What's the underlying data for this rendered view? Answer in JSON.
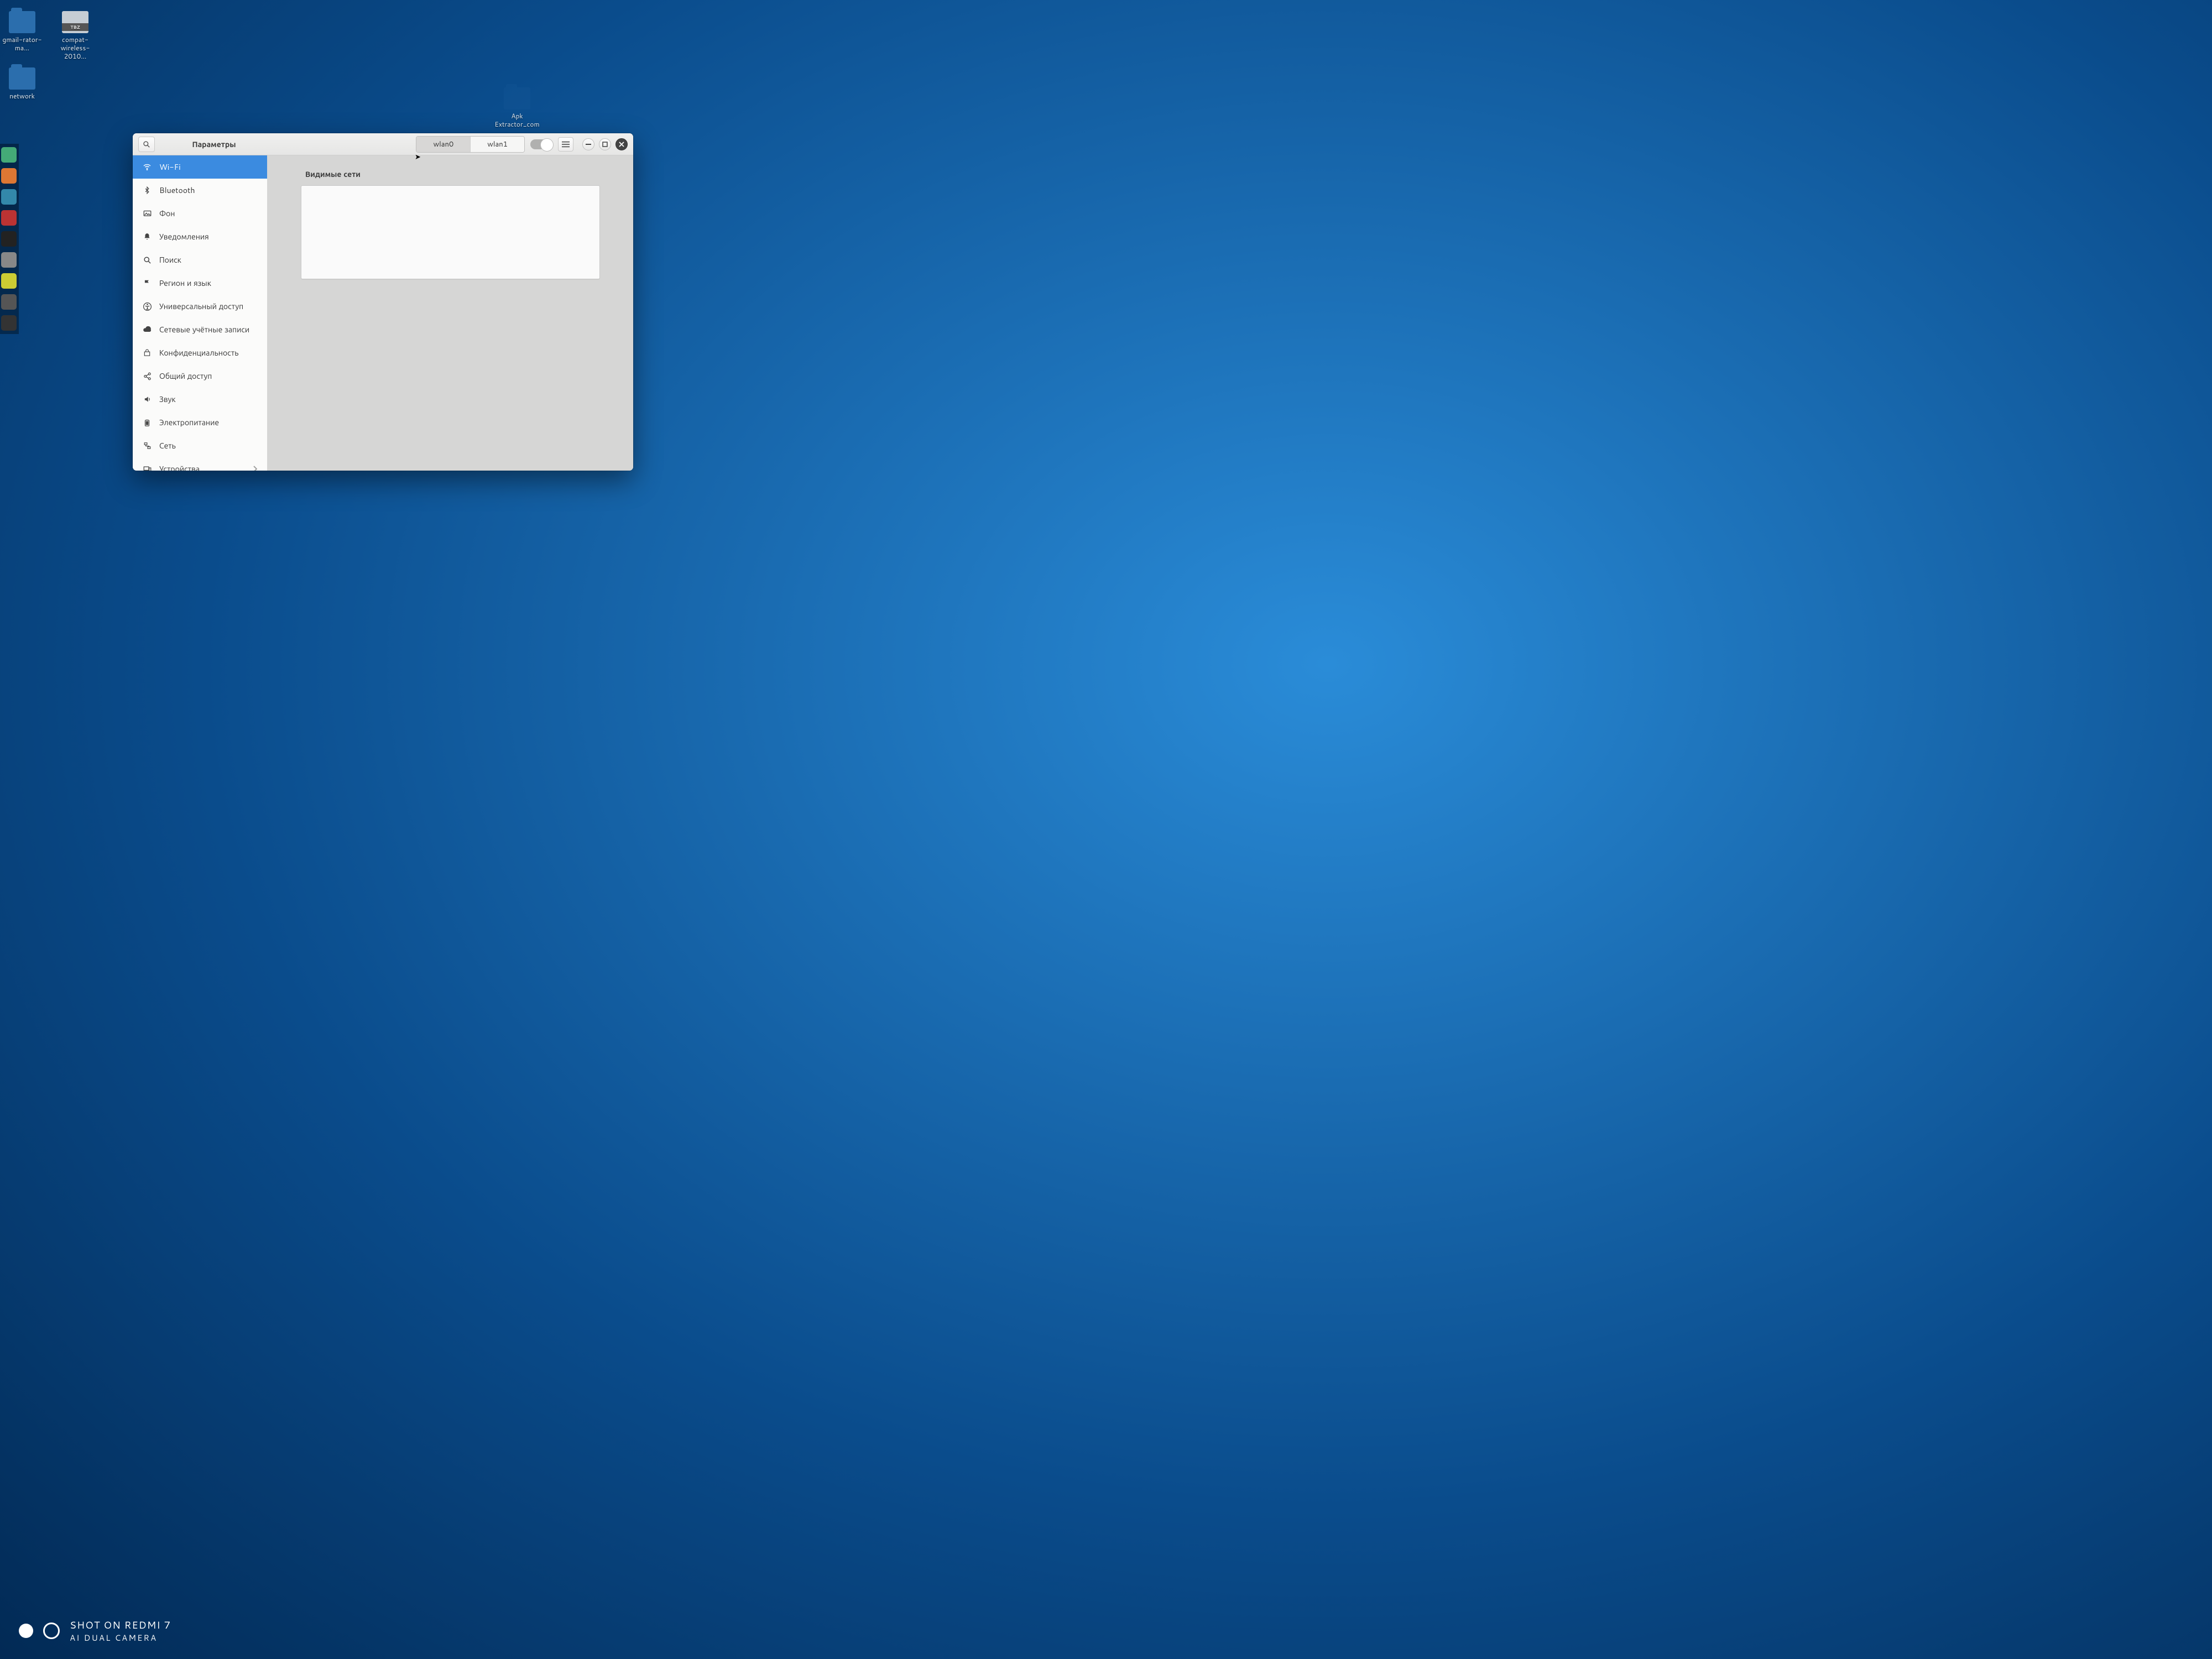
{
  "desktop": {
    "icons": [
      {
        "label": "gmail-rator-ma…",
        "type": "folder"
      },
      {
        "label": "compat-wireless-2010…",
        "type": "file"
      },
      {
        "label": "network",
        "type": "folder"
      },
      {
        "label": "Apk Extractor_com…",
        "type": "folder"
      }
    ]
  },
  "window": {
    "title": "Параметры",
    "tabs": [
      {
        "id": "wlan0",
        "label": "wlan0",
        "active": true
      },
      {
        "id": "wlan1",
        "label": "wlan1",
        "active": false
      }
    ],
    "wifi_toggle": false
  },
  "sidebar": {
    "items": [
      {
        "label": "Wi-Fi",
        "icon": "wifi",
        "active": true
      },
      {
        "label": "Bluetooth",
        "icon": "bluetooth"
      },
      {
        "label": "Фон",
        "icon": "background"
      },
      {
        "label": "Уведомления",
        "icon": "bell"
      },
      {
        "label": "Поиск",
        "icon": "search"
      },
      {
        "label": "Регион и язык",
        "icon": "flag"
      },
      {
        "label": "Универсальный доступ",
        "icon": "accessibility"
      },
      {
        "label": "Сетевые учётные записи",
        "icon": "cloud"
      },
      {
        "label": "Конфиденциальность",
        "icon": "privacy"
      },
      {
        "label": "Общий доступ",
        "icon": "share"
      },
      {
        "label": "Звук",
        "icon": "sound"
      },
      {
        "label": "Электропитание",
        "icon": "power"
      },
      {
        "label": "Сеть",
        "icon": "network"
      },
      {
        "label": "Устройства",
        "icon": "devices",
        "has_chevron": true
      }
    ]
  },
  "content": {
    "visible_networks_title": "Видимые сети"
  },
  "watermark": {
    "line1": "SHOT ON REDMI 7",
    "line2": "AI DUAL CAMERA"
  }
}
